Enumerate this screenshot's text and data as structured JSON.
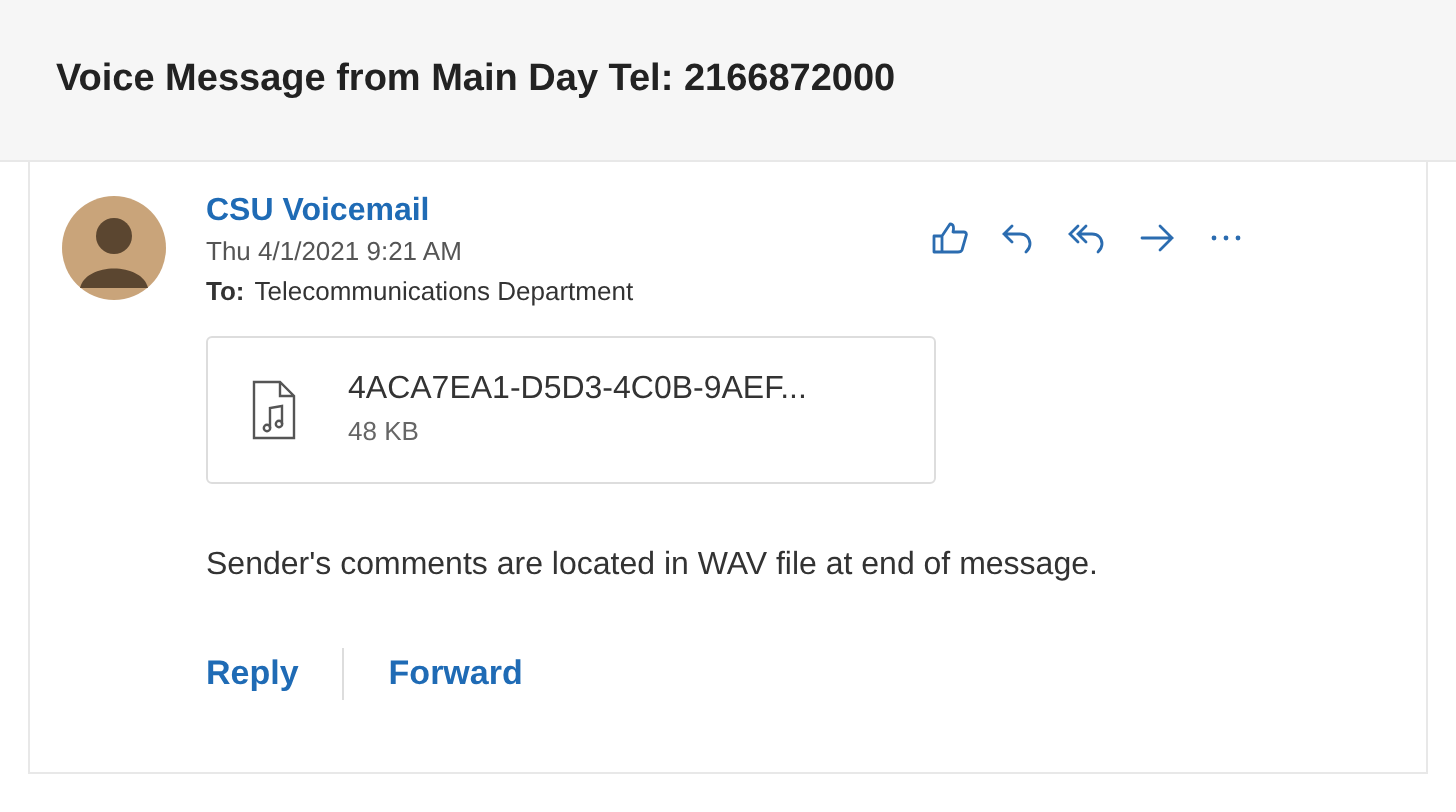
{
  "subject": "Voice Message from Main Day Tel: 2166872000",
  "message": {
    "sender": "CSU Voicemail",
    "date": "Thu 4/1/2021 9:21 AM",
    "to_label": "To:",
    "to": "Telecommunications Department",
    "attachment": {
      "name": "4ACA7EA1-D5D3-4C0B-9AEF...",
      "size": "48 KB"
    },
    "body": "Sender's comments are located in WAV file at end of message.",
    "actions": [
      {
        "kind": "like"
      },
      {
        "kind": "reply"
      },
      {
        "kind": "reply-all"
      },
      {
        "kind": "forward"
      },
      {
        "kind": "more"
      }
    ],
    "links": [
      "Reply",
      "Forward"
    ]
  }
}
